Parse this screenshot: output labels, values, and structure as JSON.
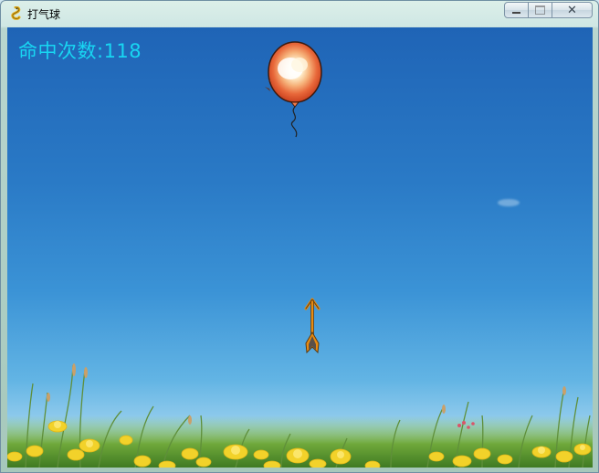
{
  "window": {
    "title": "打气球",
    "app_icon": "pygame-snake-icon",
    "caption_buttons": [
      "minimize-icon",
      "maximize-icon",
      "close-icon"
    ]
  },
  "game": {
    "score_label": "命中次数:118",
    "balloon": {
      "state": "exploding",
      "color": "#f07a4a"
    },
    "arrow": {
      "direction": "up",
      "color": "#f09a18"
    },
    "sky_color": "#2a7ac6",
    "flower_color": "#f2d22a"
  }
}
